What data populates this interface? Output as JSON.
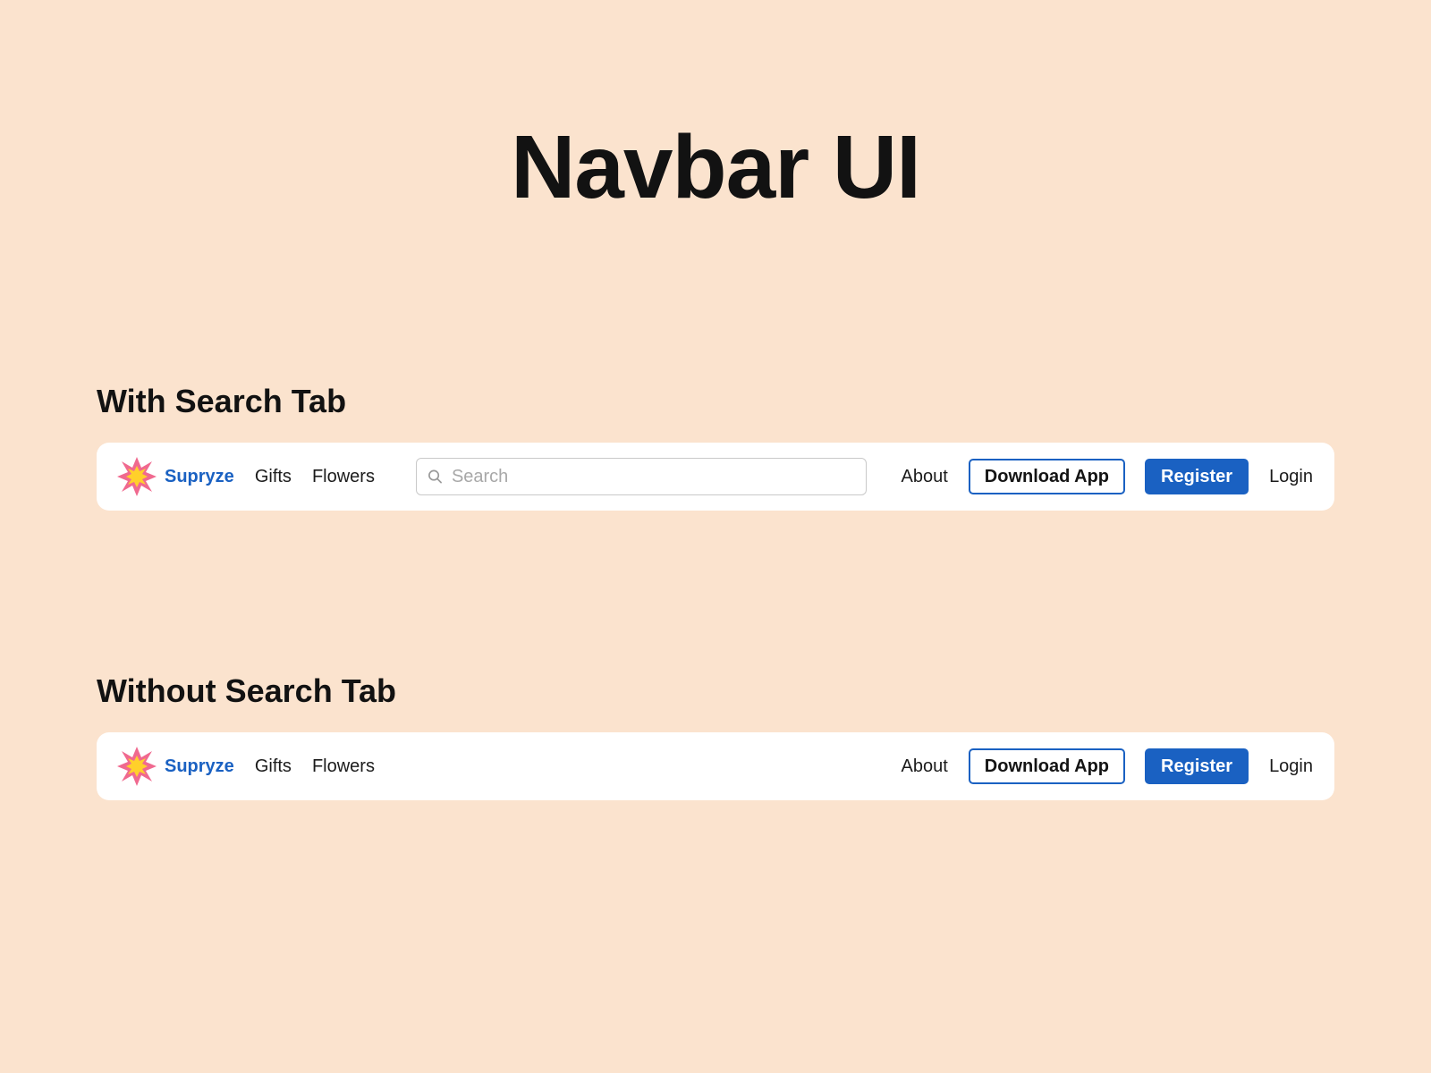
{
  "page": {
    "title": "Navbar UI",
    "background": "#fbe3ce"
  },
  "colors": {
    "brand_blue": "#1a61c2",
    "logo_pink": "#f0698f",
    "logo_yellow": "#ffd02a",
    "navbar_bg": "#ffffff"
  },
  "sections": [
    {
      "heading": "With Search Tab",
      "navbar": {
        "brand": {
          "icon": "star-burst-logo-icon",
          "name": "Supryze"
        },
        "links": [
          "Gifts",
          "Flowers"
        ],
        "search": {
          "icon": "search-icon",
          "placeholder": "Search",
          "value": ""
        },
        "about_label": "About",
        "download_label": "Download App",
        "register_label": "Register",
        "login_label": "Login"
      }
    },
    {
      "heading": "Without Search Tab",
      "navbar": {
        "brand": {
          "icon": "star-burst-logo-icon",
          "name": "Supryze"
        },
        "links": [
          "Gifts",
          "Flowers"
        ],
        "about_label": "About",
        "download_label": "Download App",
        "register_label": "Register",
        "login_label": "Login"
      }
    }
  ]
}
